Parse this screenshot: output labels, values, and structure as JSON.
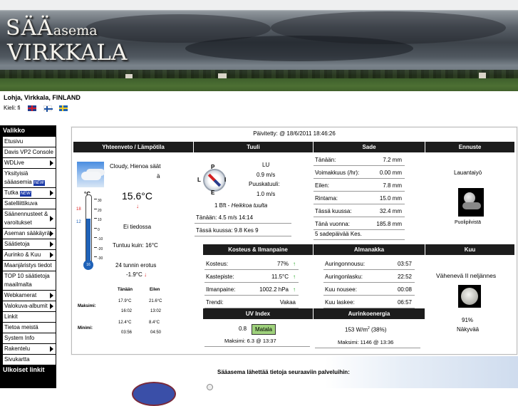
{
  "header": {
    "logo_line1": "SÄÄ",
    "logo_line1_small": "asema",
    "logo_line2": "VIRKKALA"
  },
  "location": "Lohja, Virkkala, FINLAND",
  "language": {
    "label": "Kieli: fi"
  },
  "menu": {
    "title": "Valikko",
    "items": [
      {
        "label": "Etusivu",
        "arrow": false
      },
      {
        "label": "Davis VP2 Console",
        "arrow": false
      },
      {
        "label": "WDLive",
        "arrow": true
      },
      {
        "label": "Yksityisiä sääasemia",
        "badge": "NEW",
        "arrow": false,
        "tall": true
      },
      {
        "label": "Tutka",
        "badge": "NEW",
        "arrow": true
      },
      {
        "label": "Satelliittikuva",
        "arrow": false
      },
      {
        "label": "Säänennusteet & varoitukset",
        "arrow": true,
        "tall": true
      },
      {
        "label": "Aseman sääkäyrät",
        "arrow": true
      },
      {
        "label": "Säätietoja",
        "arrow": true
      },
      {
        "label": "Aurinko & Kuu",
        "arrow": true
      },
      {
        "label": "Maanjäristys tiedot",
        "arrow": false
      },
      {
        "label": "TOP 10 säätietoja maailmalta",
        "arrow": false,
        "tall": true
      },
      {
        "label": "Webkamerat",
        "arrow": true
      },
      {
        "label": "Valokuva-albumit",
        "arrow": true
      },
      {
        "label": "Linkit",
        "arrow": false
      },
      {
        "label": "Tietoa meistä",
        "arrow": false
      },
      {
        "label": "System Info",
        "arrow": false
      },
      {
        "label": "Rakentelu",
        "arrow": true
      },
      {
        "label": "Sivukartta",
        "arrow": false
      }
    ],
    "footer": "Ulkoiset linkit"
  },
  "updated": "Päivitetty: @ 18/6/2011 18:46:26",
  "summary": {
    "header": "Yhteenveto / Lämpötila",
    "condition": "Cloudy, Hienoa säät",
    "condition2": "ä",
    "temp": "15.6°C",
    "trend": "↓",
    "feels": "Ei tiedossa",
    "dewfeel": "Tuntuu kuin: 16°C",
    "diff_label": "24 tunnin erotus",
    "diff_value": "-1.9°C",
    "thermo_unit": "°C",
    "thermo_marks": [
      "30",
      "20",
      "10",
      "0",
      "-10",
      "-20",
      "-30"
    ],
    "thermo_bulb": "16",
    "thermo_left_top": "18",
    "thermo_left_bottom": "12",
    "col_today": "Tänään",
    "col_yesterday": "Eilen",
    "max_label": "Maksimi:",
    "max_today": "17.9°C",
    "max_today_time": "16:02",
    "max_yesterday": "21.6°C",
    "max_yesterday_time": "13:02",
    "min_label": "Minimi:",
    "min_today": "12.4°C",
    "min_today_time": "03:56",
    "min_yesterday": "8.4°C",
    "min_yesterday_time": "04:50"
  },
  "wind": {
    "header": "Tuuli",
    "dir": "LU",
    "speed": "0.9 m/s",
    "gust_label": "Puuskatuuli:",
    "gust": "1.0 m/s",
    "bft": "1 Bft - ",
    "bft_desc": "Heikkoa tuulta",
    "today": "Tänään: 4.5 m/s 14:14",
    "month": "Tässä kuussa: 9.8 Kes 9",
    "compass_n": "P",
    "compass_w": "L",
    "compass_e": "I",
    "compass_s": "E"
  },
  "rain": {
    "header": "Sade",
    "rows": [
      {
        "label": "Tänään:",
        "value": "7.2 mm"
      },
      {
        "label": "Voimakkuus (/hr):",
        "value": "0.00 mm"
      },
      {
        "label": "Eilen:",
        "value": "7.8 mm"
      },
      {
        "label": "Rintama:",
        "value": "15.0 mm"
      },
      {
        "label": "Tässä kuussa:",
        "value": "32.4 mm"
      },
      {
        "label": "Tänä vuonna:",
        "value": "185.8 mm"
      }
    ],
    "rain_days": "5 sadepäivää Kes."
  },
  "forecast": {
    "header": "Ennuste",
    "day": "Lauantaiyö",
    "desc": "Puolipilvistä"
  },
  "humidity": {
    "header": "Kosteus & Ilmanpaine",
    "rows": [
      {
        "label": "Kosteus:",
        "value": "77%",
        "trend": "up"
      },
      {
        "label": "Kastepiste:",
        "value": "11.5°C",
        "trend": "up"
      },
      {
        "label": "Ilmanpaine:",
        "value": "1002.2 hPa",
        "trend": "up"
      },
      {
        "label": "Trendi:",
        "value": "Vakaa",
        "trend": ""
      }
    ]
  },
  "almanac": {
    "header": "Almanakka",
    "rows": [
      {
        "label": "Auringonnousu:",
        "value": "03:57"
      },
      {
        "label": "Auringonlasku:",
        "value": "22:52"
      },
      {
        "label": "Kuu nousee:",
        "value": "00:08"
      },
      {
        "label": "Kuu laskee:",
        "value": "06:57"
      }
    ]
  },
  "moon": {
    "header": "Kuu",
    "phase": "Vähenevä II neljännes",
    "percent": "91%",
    "visible": "Näkyvää"
  },
  "uv": {
    "header": "UV Index",
    "value": "0.8",
    "level": "Matala",
    "max": "Maksimi: 6.3 @ 13:37"
  },
  "solar": {
    "header": "Aurinkoenergia",
    "value": "153 W/m",
    "sup": "2",
    "pct": " (38%)",
    "max": "Maksimi: 1146 @  13:36"
  },
  "footer": {
    "text": "Sääasema lähettää tietoja seuraaviin palveluihin:"
  },
  "colors": {
    "header_bg": "#1c1c1c",
    "uv_low": "#9fd27c",
    "trend_up": "#1aa31a",
    "trend_down": "#d22222"
  }
}
